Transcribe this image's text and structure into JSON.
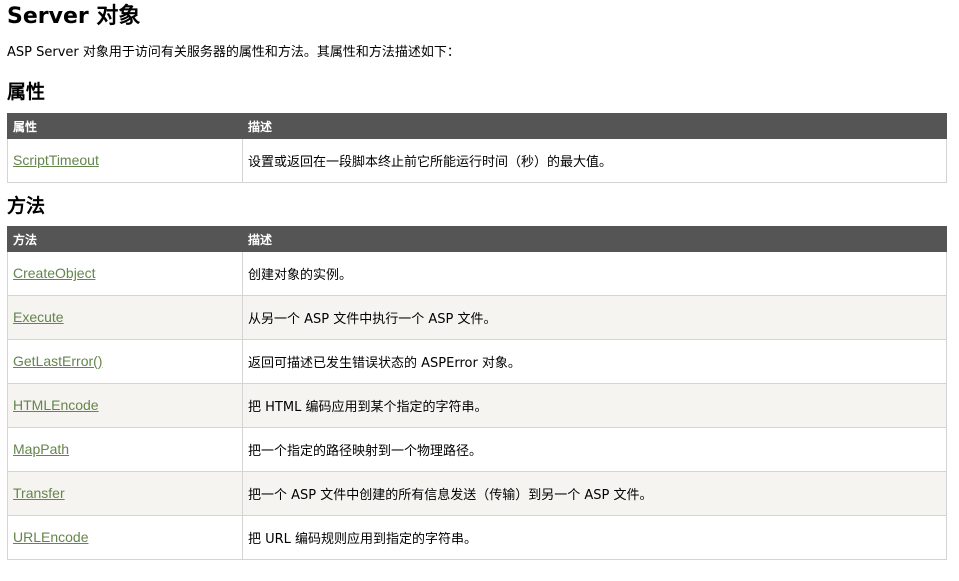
{
  "page": {
    "title": "Server 对象",
    "intro": "ASP Server 对象用于访问有关服务器的属性和方法。其属性和方法描述如下："
  },
  "properties": {
    "heading": "属性",
    "columns": [
      "属性",
      "描述"
    ],
    "rows": [
      {
        "name": "ScriptTimeout",
        "desc": "设置或返回在一段脚本终止前它所能运行时间（秒）的最大值。"
      }
    ]
  },
  "methods": {
    "heading": "方法",
    "columns": [
      "方法",
      "描述"
    ],
    "rows": [
      {
        "name": "CreateObject",
        "desc": "创建对象的实例。"
      },
      {
        "name": "Execute",
        "desc": "从另一个 ASP 文件中执行一个 ASP 文件。"
      },
      {
        "name": "GetLastError()",
        "desc": "返回可描述已发生错误状态的 ASPError 对象。"
      },
      {
        "name": "HTMLEncode",
        "desc": "把 HTML 编码应用到某个指定的字符串。"
      },
      {
        "name": "MapPath",
        "desc": "把一个指定的路径映射到一个物理路径。"
      },
      {
        "name": "Transfer",
        "desc": "把一个 ASP 文件中创建的所有信息发送（传输）到另一个 ASP 文件。"
      },
      {
        "name": "URLEncode",
        "desc": "把 URL 编码规则应用到指定的字符串。"
      }
    ]
  },
  "colors": {
    "header_bg": "#555555",
    "link": "#64854c",
    "alt_row": "#f6f4f0",
    "border": "#d4d4d4"
  }
}
